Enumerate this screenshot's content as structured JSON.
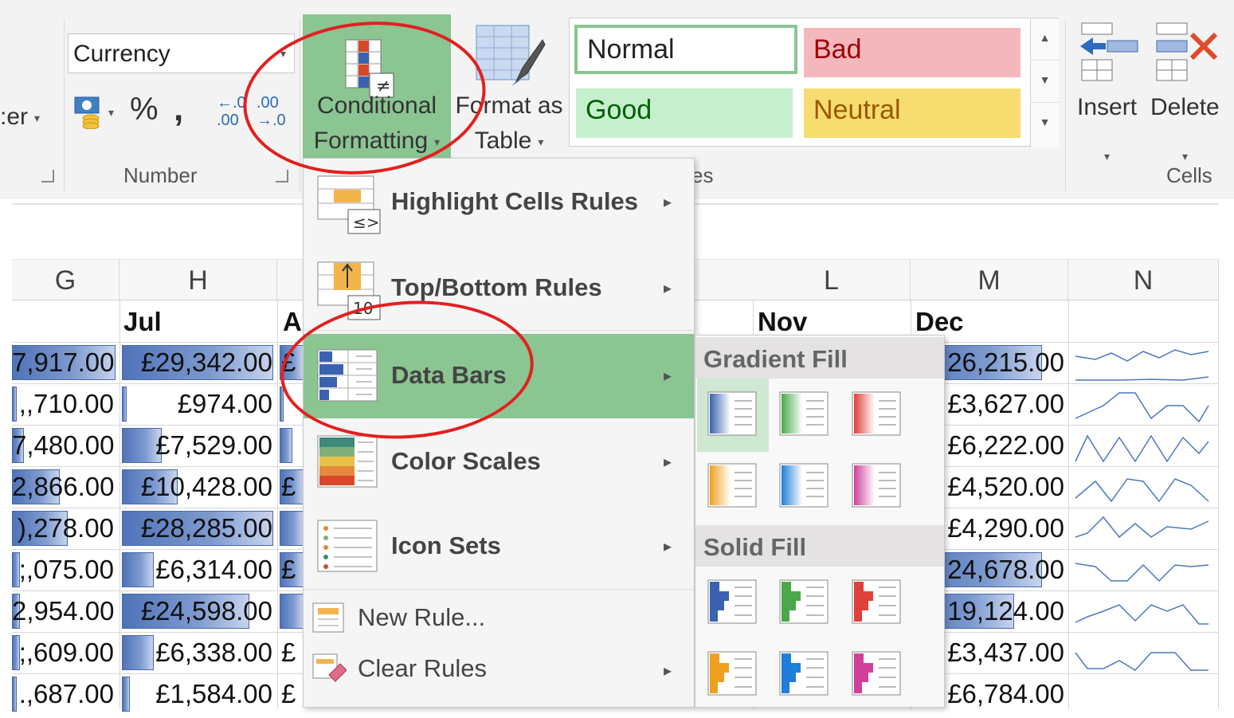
{
  "ribbon": {
    "left_cut_label": ":er",
    "number_group": {
      "format_value": "Currency",
      "percent": "%",
      "comma": ",",
      "inc_decimal_top": "←.0",
      "inc_decimal_bottom": ".00",
      "dec_decimal_top": ".00",
      "dec_decimal_bottom": "→.0",
      "label": "Number"
    },
    "conditional_formatting": {
      "line1": "Conditional",
      "line2": "Formatting"
    },
    "format_as_table": {
      "line1": "Format as",
      "line2": "Table"
    },
    "styles": {
      "normal": "Normal",
      "bad": "Bad",
      "good": "Good",
      "neutral": "Neutral",
      "group_label_partial": "es",
      "colors": {
        "normal_border": "#8ac592",
        "bad_bg": "#f4b8bc",
        "bad_text": "#9c0006",
        "good_bg": "#c6efce",
        "good_text": "#006100",
        "neutral_bg": "#f7dc6f",
        "neutral_text": "#9c5700"
      }
    },
    "cells": {
      "insert": "Insert",
      "delete": "Delete",
      "label": "Cells"
    }
  },
  "grid": {
    "columns": [
      "G",
      "H",
      "A",
      "L",
      "M",
      "N"
    ],
    "months": {
      "h": "Jul",
      "a": "A",
      "l": "Nov",
      "m": "Dec"
    },
    "rows": [
      {
        "g": "7,917.00",
        "h": "£29,342.00",
        "a": "£",
        "m": "26,215.00"
      },
      {
        "g": ",,710.00",
        "h": "£974.00",
        "a": "",
        "m": "£3,627.00"
      },
      {
        "g": "7,480.00",
        "h": "£7,529.00",
        "a": "",
        "m": "£6,222.00"
      },
      {
        "g": "2,866.00",
        "h": "£10,428.00",
        "a": "£",
        "m": "£4,520.00"
      },
      {
        "g": "),278.00",
        "h": "£28,285.00",
        "a": "",
        "m": "£4,290.00"
      },
      {
        "g": ";,075.00",
        "h": "£6,314.00",
        "a": "£",
        "m": "24,678.00"
      },
      {
        "g": "2,954.00",
        "h": "£24,598.00",
        "a": "",
        "m": "19,124.00"
      },
      {
        "g": ";,609.00",
        "h": "£6,338.00",
        "a": "£",
        "m": "£3,437.00"
      },
      {
        "g": ".,687.00",
        "h": "£1,584.00",
        "a": "£",
        "m": "£6,784.00"
      }
    ]
  },
  "menu": {
    "items": [
      {
        "label": "Highlight Cells Rules",
        "has_submenu": true
      },
      {
        "label": "Top/Bottom Rules",
        "has_submenu": true
      },
      {
        "label": "Data Bars",
        "has_submenu": true
      },
      {
        "label": "Color Scales",
        "has_submenu": true
      },
      {
        "label": "Icon Sets",
        "has_submenu": true
      }
    ],
    "new_rule": "New Rule...",
    "clear_rules": "Clear Rules",
    "manage_rules_partial": "",
    "highlight_color": "#8ac592"
  },
  "submenu": {
    "gradient_fill": "Gradient Fill",
    "solid_fill": "Solid Fill",
    "gradient_colors": [
      "blue",
      "green",
      "red",
      "orange",
      "light-blue",
      "purple"
    ],
    "solid_colors": [
      "blue",
      "green",
      "red",
      "orange",
      "light-blue",
      "purple"
    ]
  },
  "annotation_color": "#e2201f"
}
